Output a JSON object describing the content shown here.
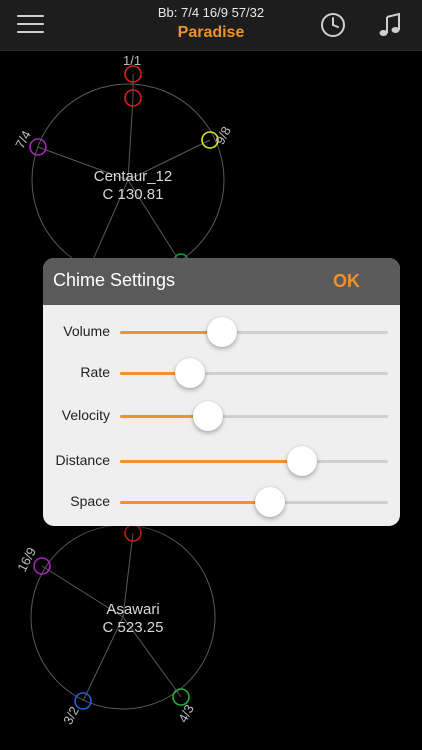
{
  "header": {
    "status": "Bb: 7/4 16/9 57/32",
    "title": "Paradise",
    "menu_icon": "hamburger-menu-icon",
    "clock_icon": "clock-icon",
    "music_icon": "music-note-icon"
  },
  "colors": {
    "accent": "#f0922b",
    "node_red": "#d42020",
    "node_purple": "#a028b4",
    "node_yellow": "#e0e020",
    "node_green": "#20b040",
    "node_blue": "#2060d8"
  },
  "diagram_top": {
    "name": "Centaur_12",
    "pitch": "C 130.81",
    "ratios": [
      "1/1",
      "7/4",
      "9/8"
    ]
  },
  "diagram_bottom": {
    "name": "Asawari",
    "pitch": "C 523.25",
    "ratios": [
      "16/9",
      "3/2",
      "4/3"
    ]
  },
  "dialog": {
    "title": "Chime Settings",
    "ok_label": "OK",
    "sliders": [
      {
        "label": "Volume",
        "value": 0.38
      },
      {
        "label": "Rate",
        "value": 0.26
      },
      {
        "label": "Velocity",
        "value": 0.33
      },
      {
        "label": "Distance",
        "value": 0.68
      },
      {
        "label": "Space",
        "value": 0.56
      }
    ]
  }
}
